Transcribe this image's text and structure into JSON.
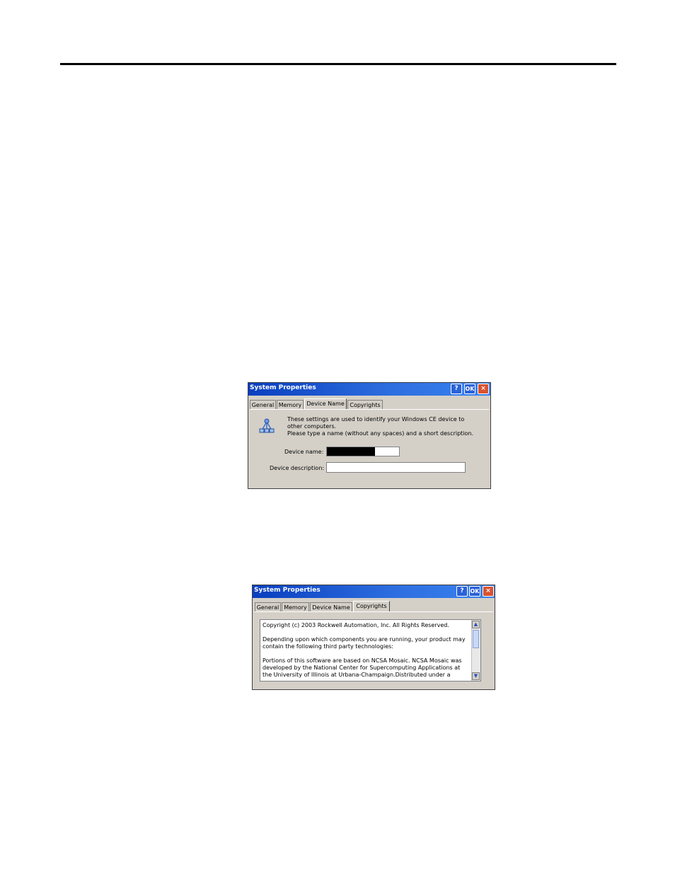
{
  "dialog1": {
    "title": "System Properties",
    "help_label": "?",
    "ok_label": "OK",
    "close_label": "×",
    "tabs": [
      {
        "label": "General"
      },
      {
        "label": "Memory"
      },
      {
        "label": "Device Name"
      },
      {
        "label": "Copyrights"
      }
    ],
    "active_tab": "Device Name",
    "description_lines": [
      "These settings are used to identify your Windows CE device to",
      "other computers.",
      "Please type a name (without any spaces) and a short description."
    ],
    "device_name_label": "Device name:",
    "device_description_label": "Device description:",
    "icon": "network-computers-icon"
  },
  "dialog2": {
    "title": "System Properties",
    "help_label": "?",
    "ok_label": "OK",
    "close_label": "×",
    "tabs": [
      {
        "label": "General"
      },
      {
        "label": "Memory"
      },
      {
        "label": "Device Name"
      },
      {
        "label": "Copyrights"
      }
    ],
    "active_tab": "Copyrights",
    "copyright_lines": [
      "Copyright (c) 2003 Rockwell Automation, Inc.  All Rights Reserved.",
      "",
      "Depending upon which components you are running, your product may",
      "contain the following third party technologies:",
      "",
      "Portions of this software are based on NCSA Mosaic. NCSA Mosaic was",
      "developed by the National Center for Supercomputing Applications at",
      "the University of Illinois at Urbana-Champaign.Distributed under a"
    ],
    "scroll_up_icon": "scroll-up-arrow-icon",
    "scroll_down_icon": "scroll-down-arrow-icon"
  }
}
